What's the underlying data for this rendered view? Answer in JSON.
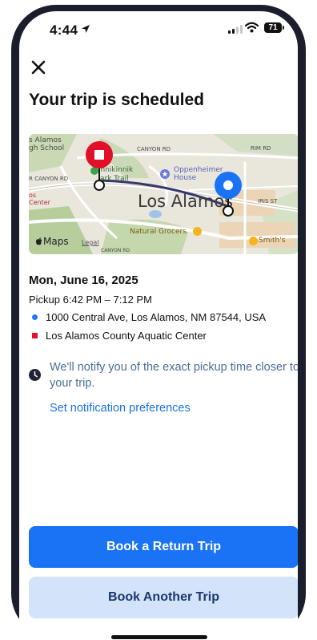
{
  "status_bar": {
    "time": "4:44",
    "battery": "71"
  },
  "header": {
    "close_icon": "close-icon",
    "title": "Your trip is scheduled"
  },
  "map": {
    "city_label": "Los Alamos",
    "labels": {
      "school": "s Alamos\ngh School",
      "canyon_rd_1": "CANYON RD",
      "canyon_rd_2": "R  CANYON RD",
      "kinnikinnik": "innikinnik",
      "park_trail": "ark Trail",
      "oppenheimer": "Oppenheimer\nHouse",
      "rim_rd": "RIM RD",
      "iris_st": "IRIS ST",
      "os_center": "os\nCenter",
      "natural_grocers": "Natural Grocers",
      "smiths": "Smith's",
      "maps": "Maps",
      "legal": "Legal",
      "canyon_rd_3": "CANYON RD"
    },
    "pin_colors": {
      "origin": "#1a73f5",
      "destination": "#e0102a"
    }
  },
  "trip": {
    "date": "Mon, June 16, 2025",
    "pickup_window": "Pickup 6:42 PM – 7:12 PM",
    "origin": "1000 Central Ave, Los Alamos, NM 87544, USA",
    "destination": "Los Alamos County Aquatic Center"
  },
  "notification": {
    "message": "We'll notify you of the exact pickup time closer to your trip.",
    "link": "Set notification preferences"
  },
  "actions": {
    "book_return": "Book a Return Trip",
    "book_another": "Book Another Trip"
  }
}
